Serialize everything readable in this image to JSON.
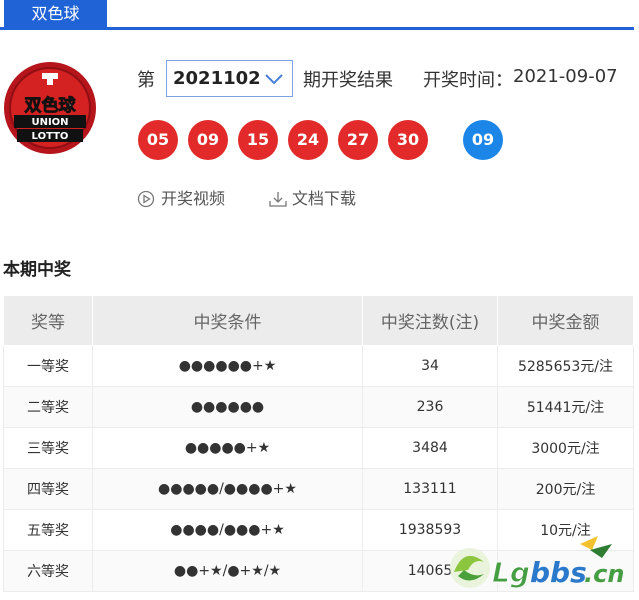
{
  "tab": {
    "label": "双色球"
  },
  "draw": {
    "prefix": "第",
    "period": "2021102",
    "suffix": "期开奖结果",
    "time_label": "开奖时间：",
    "time_value": "2021-09-07"
  },
  "balls": {
    "red": [
      "05",
      "09",
      "15",
      "24",
      "27",
      "30"
    ],
    "blue": [
      "09"
    ],
    "red_color": "#e32a2a",
    "blue_color": "#1b86e8"
  },
  "links": {
    "video": "开奖视频",
    "download": "文档下载"
  },
  "section": {
    "title": "本期中奖"
  },
  "table": {
    "headers": [
      "奖等",
      "中奖条件",
      "中奖注数(注)",
      "中奖金额"
    ],
    "rows": [
      [
        "一等奖",
        "●●●●●●+★",
        "34",
        "5285653元/注"
      ],
      [
        "二等奖",
        "●●●●●●",
        "236",
        "51441元/注"
      ],
      [
        "三等奖",
        "●●●●●+★",
        "3484",
        "3000元/注"
      ],
      [
        "四等奖",
        "●●●●●/●●●●+★",
        "133111",
        "200元/注"
      ],
      [
        "五等奖",
        "●●●●/●●●+★",
        "1938593",
        "10元/注"
      ],
      [
        "六等奖",
        "●●+★/●+★/★",
        "14065",
        ""
      ]
    ]
  },
  "logo": {
    "text_top": "双色球",
    "text_bottom": "UNION LOTTO"
  },
  "watermark": {
    "text": "Lgbbs.cn"
  },
  "accent": "#1f63d6"
}
